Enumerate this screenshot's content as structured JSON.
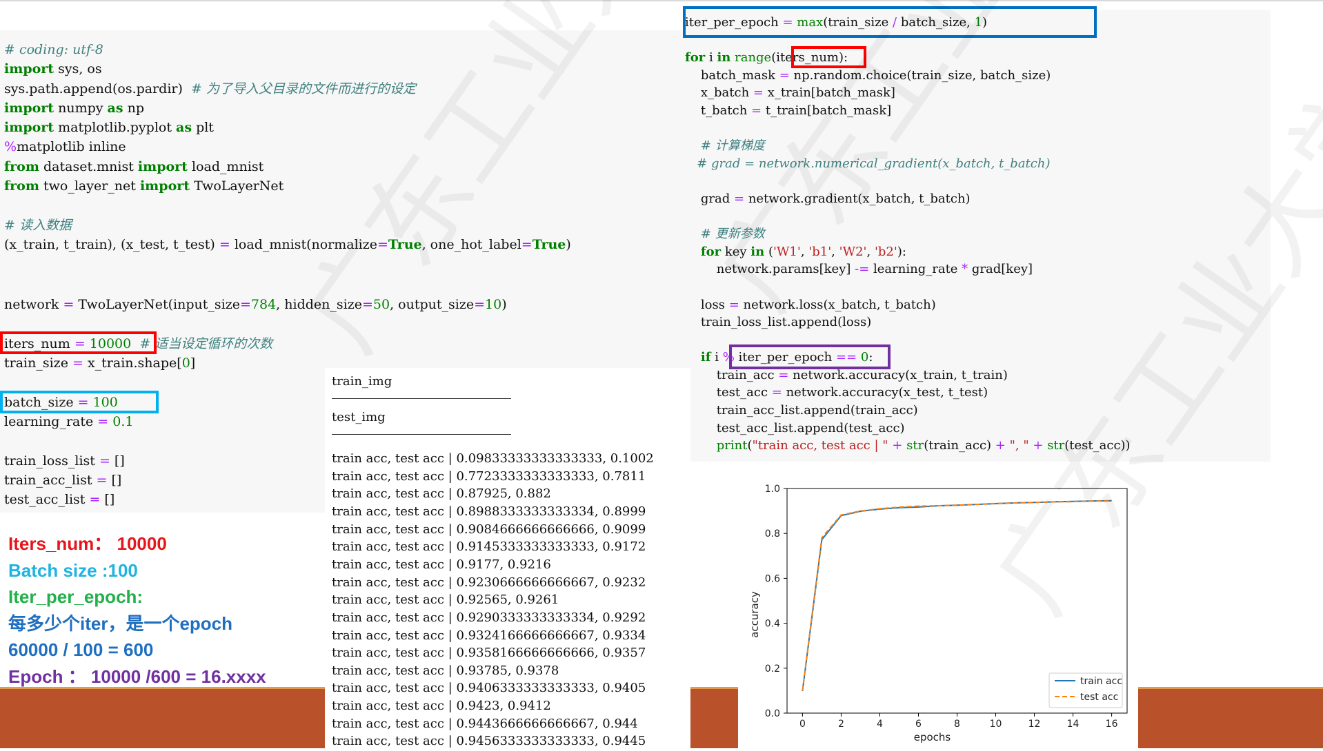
{
  "left_code": {
    "lines": [
      [
        {
          "t": "# coding: utf-8",
          "c": "cm"
        }
      ],
      [
        {
          "t": "import",
          "c": "kw"
        },
        {
          "t": " sys, os"
        }
      ],
      [
        {
          "t": "sys.path.append(os.pardir)  "
        },
        {
          "t": "# 为了导入父目录的文件而进行的设定",
          "c": "cm"
        }
      ],
      [
        {
          "t": "import",
          "c": "kw"
        },
        {
          "t": " numpy "
        },
        {
          "t": "as",
          "c": "kw"
        },
        {
          "t": " np"
        }
      ],
      [
        {
          "t": "import",
          "c": "kw"
        },
        {
          "t": " matplotlib.pyplot "
        },
        {
          "t": "as",
          "c": "kw"
        },
        {
          "t": " plt"
        }
      ],
      [
        {
          "t": "%",
          "c": "op"
        },
        {
          "t": "matplotlib inline"
        }
      ],
      [
        {
          "t": "from",
          "c": "kw"
        },
        {
          "t": " dataset.mnist "
        },
        {
          "t": "import",
          "c": "kw"
        },
        {
          "t": " load_mnist"
        }
      ],
      [
        {
          "t": "from",
          "c": "kw"
        },
        {
          "t": " two_layer_net "
        },
        {
          "t": "import",
          "c": "kw"
        },
        {
          "t": " TwoLayerNet"
        }
      ],
      [],
      [
        {
          "t": "# 读入数据",
          "c": "cm"
        }
      ],
      [
        {
          "t": "(x_train, t_train), (x_test, t_test) "
        },
        {
          "t": "=",
          "c": "op"
        },
        {
          "t": " load_mnist(normalize"
        },
        {
          "t": "=",
          "c": "op"
        },
        {
          "t": "True",
          "c": "kw"
        },
        {
          "t": ", one_hot_label"
        },
        {
          "t": "=",
          "c": "op"
        },
        {
          "t": "True",
          "c": "kw"
        },
        {
          "t": ")"
        }
      ]
    ],
    "network_line": [
      {
        "t": "network "
      },
      {
        "t": "=",
        "c": "op"
      },
      {
        "t": " TwoLayerNet(input_size"
      },
      {
        "t": "=",
        "c": "op"
      },
      {
        "t": "784",
        "c": "num"
      },
      {
        "t": ", hidden_size"
      },
      {
        "t": "=",
        "c": "op"
      },
      {
        "t": "50",
        "c": "num"
      },
      {
        "t": ", output_size"
      },
      {
        "t": "=",
        "c": "op"
      },
      {
        "t": "10",
        "c": "num"
      },
      {
        "t": ")"
      }
    ],
    "hyper_lines": [
      [
        {
          "t": "iters_num "
        },
        {
          "t": "=",
          "c": "op"
        },
        {
          "t": " 10000",
          "c": "num"
        },
        {
          "t": "  "
        },
        {
          "t": "# 适当设定循环的次数",
          "c": "cm"
        }
      ],
      [
        {
          "t": "train_size "
        },
        {
          "t": "=",
          "c": "op"
        },
        {
          "t": " x_train.shape["
        },
        {
          "t": "0",
          "c": "num"
        },
        {
          "t": "]"
        }
      ],
      [],
      [
        {
          "t": "batch_size "
        },
        {
          "t": "=",
          "c": "op"
        },
        {
          "t": " 100",
          "c": "num"
        }
      ],
      [
        {
          "t": "learning_rate "
        },
        {
          "t": "=",
          "c": "op"
        },
        {
          "t": " 0.1",
          "c": "num"
        }
      ],
      [],
      [
        {
          "t": "train_loss_list "
        },
        {
          "t": "=",
          "c": "op"
        },
        {
          "t": " []"
        }
      ],
      [
        {
          "t": "train_acc_list "
        },
        {
          "t": "=",
          "c": "op"
        },
        {
          "t": " []"
        }
      ],
      [
        {
          "t": "test_acc_list "
        },
        {
          "t": "=",
          "c": "op"
        },
        {
          "t": " []"
        }
      ]
    ]
  },
  "right_code": {
    "lines": [
      [
        {
          "t": "iter_per_epoch "
        },
        {
          "t": "=",
          "c": "op"
        },
        {
          "t": " "
        },
        {
          "t": "max",
          "c": "bi"
        },
        {
          "t": "(train_size "
        },
        {
          "t": "/",
          "c": "op"
        },
        {
          "t": " batch_size, "
        },
        {
          "t": "1",
          "c": "num"
        },
        {
          "t": ")"
        }
      ],
      [],
      [
        {
          "t": "for",
          "c": "kw"
        },
        {
          "t": " i "
        },
        {
          "t": "in",
          "c": "kw"
        },
        {
          "t": " "
        },
        {
          "t": "range",
          "c": "bi"
        },
        {
          "t": "(iters_num):"
        }
      ],
      [
        {
          "t": "    batch_mask "
        },
        {
          "t": "=",
          "c": "op"
        },
        {
          "t": " np.random.choice(train_size, batch_size)"
        }
      ],
      [
        {
          "t": "    x_batch "
        },
        {
          "t": "=",
          "c": "op"
        },
        {
          "t": " x_train[batch_mask]"
        }
      ],
      [
        {
          "t": "    t_batch "
        },
        {
          "t": "=",
          "c": "op"
        },
        {
          "t": " t_train[batch_mask]"
        }
      ],
      [],
      [
        {
          "t": "    "
        },
        {
          "t": "# 计算梯度",
          "c": "cm"
        }
      ],
      [
        {
          "t": "   "
        },
        {
          "t": "# grad = network.numerical_gradient(x_batch, t_batch)",
          "c": "cm"
        }
      ],
      [],
      [
        {
          "t": "    grad "
        },
        {
          "t": "=",
          "c": "op"
        },
        {
          "t": " network.gradient(x_batch, t_batch)"
        }
      ],
      [],
      [
        {
          "t": "    "
        },
        {
          "t": "# 更新参数",
          "c": "cm"
        }
      ],
      [
        {
          "t": "    "
        },
        {
          "t": "for",
          "c": "kw"
        },
        {
          "t": " key "
        },
        {
          "t": "in",
          "c": "kw"
        },
        {
          "t": " ("
        },
        {
          "t": "'W1'",
          "c": "str"
        },
        {
          "t": ", "
        },
        {
          "t": "'b1'",
          "c": "str"
        },
        {
          "t": ", "
        },
        {
          "t": "'W2'",
          "c": "str"
        },
        {
          "t": ", "
        },
        {
          "t": "'b2'",
          "c": "str"
        },
        {
          "t": "):"
        }
      ],
      [
        {
          "t": "        network.params[key] "
        },
        {
          "t": "-=",
          "c": "op"
        },
        {
          "t": " learning_rate "
        },
        {
          "t": "*",
          "c": "op"
        },
        {
          "t": " grad[key]"
        }
      ],
      [],
      [
        {
          "t": "    loss "
        },
        {
          "t": "=",
          "c": "op"
        },
        {
          "t": " network.loss(x_batch, t_batch)"
        }
      ],
      [
        {
          "t": "    train_loss_list.append(loss)"
        }
      ],
      [],
      [
        {
          "t": "    "
        },
        {
          "t": "if",
          "c": "kw"
        },
        {
          "t": " i "
        },
        {
          "t": "%",
          "c": "op"
        },
        {
          "t": " iter_per_epoch "
        },
        {
          "t": "==",
          "c": "op"
        },
        {
          "t": " "
        },
        {
          "t": "0",
          "c": "num"
        },
        {
          "t": ":"
        }
      ],
      [
        {
          "t": "        train_acc "
        },
        {
          "t": "=",
          "c": "op"
        },
        {
          "t": " network.accuracy(x_train, t_train)"
        }
      ],
      [
        {
          "t": "        test_acc "
        },
        {
          "t": "=",
          "c": "op"
        },
        {
          "t": " network.accuracy(x_test, t_test)"
        }
      ],
      [
        {
          "t": "        train_acc_list.append(train_acc)"
        }
      ],
      [
        {
          "t": "        test_acc_list.append(test_acc)"
        }
      ],
      [
        {
          "t": "        "
        },
        {
          "t": "print",
          "c": "bi"
        },
        {
          "t": "(",
          "c": ""
        },
        {
          "t": "\"train acc, test acc | \"",
          "c": "str"
        },
        {
          "t": " "
        },
        {
          "t": "+",
          "c": "op"
        },
        {
          "t": " "
        },
        {
          "t": "str",
          "c": "bi"
        },
        {
          "t": "(train_acc) "
        },
        {
          "t": "+",
          "c": "op"
        },
        {
          "t": " "
        },
        {
          "t": "\", \"",
          "c": "str"
        },
        {
          "t": " "
        },
        {
          "t": "+",
          "c": "op"
        },
        {
          "t": " "
        },
        {
          "t": "str",
          "c": "bi"
        },
        {
          "t": "(test_acc))"
        }
      ]
    ]
  },
  "output": {
    "header1": "train_img",
    "header2": "test_img",
    "rows": [
      "train acc, test acc | 0.09833333333333333, 0.1002",
      "train acc, test acc | 0.7723333333333333, 0.7811",
      "train acc, test acc | 0.87925, 0.882",
      "train acc, test acc | 0.8988333333333334, 0.8999",
      "train acc, test acc | 0.9084666666666666, 0.9099",
      "train acc, test acc | 0.9145333333333333, 0.9172",
      "train acc, test acc | 0.9177, 0.9216",
      "train acc, test acc | 0.9230666666666667, 0.9232",
      "train acc, test acc | 0.92565, 0.9261",
      "train acc, test acc | 0.9290333333333334, 0.9292",
      "train acc, test acc | 0.9324166666666667, 0.9334",
      "train acc, test acc | 0.9358166666666666, 0.9357",
      "train acc, test acc | 0.93785, 0.9378",
      "train acc, test acc | 0.9406333333333333, 0.9405",
      "train acc, test acc | 0.9423, 0.9412",
      "train acc, test acc | 0.9443666666666667, 0.944",
      "train acc, test acc | 0.9456333333333333, 0.9445"
    ]
  },
  "notes": [
    {
      "text": "Iters_num：  10000",
      "color": "#e8141b"
    },
    {
      "text": "Batch size :100",
      "color": "#20b2e0"
    },
    {
      "text": "Iter_per_epoch:",
      "color": "#22b04a"
    },
    {
      "text": "每多少个iter，是一个epoch",
      "color": "#1f6fc0"
    },
    {
      "text": "60000 / 100 = 600",
      "color": "#1f6fc0"
    },
    {
      "text": "Epoch ：  10000 /600 = 16.xxxx",
      "color": "#7030a0"
    }
  ],
  "highlight_colors": {
    "iters": "#ff0000",
    "batch": "#00b0f0",
    "iter_per_epoch": "#0070c0",
    "epoch_check": "#7030a0"
  },
  "chart_data": {
    "type": "line",
    "xlabel": "epochs",
    "ylabel": "accuracy",
    "xlim": [
      -0.8,
      16.8
    ],
    "ylim": [
      0.0,
      1.0
    ],
    "xticks": [
      0,
      2,
      4,
      6,
      8,
      10,
      12,
      14,
      16
    ],
    "yticks": [
      0.0,
      0.2,
      0.4,
      0.6,
      0.8,
      1.0
    ],
    "x": [
      0,
      1,
      2,
      3,
      4,
      5,
      6,
      7,
      8,
      9,
      10,
      11,
      12,
      13,
      14,
      15,
      16
    ],
    "series": [
      {
        "name": "train acc",
        "color": "#1f77b4",
        "dash": "solid",
        "values": [
          0.0983,
          0.7723,
          0.8793,
          0.8988,
          0.9085,
          0.9145,
          0.9177,
          0.9231,
          0.9257,
          0.929,
          0.9324,
          0.9358,
          0.9379,
          0.9406,
          0.9423,
          0.9444,
          0.9456
        ]
      },
      {
        "name": "test acc",
        "color": "#ff7f0e",
        "dash": "dashed",
        "values": [
          0.1002,
          0.7811,
          0.882,
          0.8999,
          0.9099,
          0.9172,
          0.9216,
          0.9232,
          0.9261,
          0.9292,
          0.9334,
          0.9357,
          0.9378,
          0.9405,
          0.9412,
          0.944,
          0.9445
        ]
      }
    ],
    "legend_position": "bottom-right"
  },
  "watermark": "广东工业大学"
}
